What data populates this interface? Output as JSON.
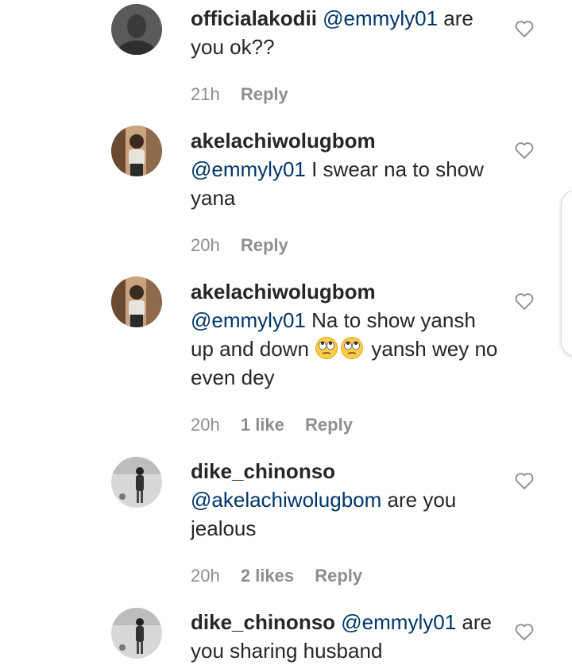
{
  "comments": [
    {
      "username": "officialakodii",
      "mention": "@emmyly01",
      "text": "are you ok??",
      "time": "21h",
      "likes": "",
      "reply": "Reply",
      "avatar": "dark-face-avatar"
    },
    {
      "username": "akelachiwolugbom",
      "mention": "@emmyly01",
      "text": "I swear na to show yana",
      "time": "20h",
      "likes": "",
      "reply": "Reply",
      "avatar": "woman-photo-avatar"
    },
    {
      "username": "akelachiwolugbom",
      "mention": "@emmyly01",
      "text_before_emoji": "Na to show yansh up and down",
      "emoji": "face-with-rolling-eyes x2",
      "text_after_emoji": "yansh wey no even dey",
      "time": "20h",
      "likes": "1 like",
      "reply": "Reply",
      "avatar": "woman-photo-avatar"
    },
    {
      "username": "dike_chinonso",
      "mention": "@akelachiwolugbom",
      "text": "are you jealous",
      "time": "20h",
      "likes": "2 likes",
      "reply": "Reply",
      "avatar": "standing-figure-avatar"
    },
    {
      "username": "dike_chinonso",
      "mention": "@emmyly01",
      "text": "are you sharing husband",
      "avatar": "standing-figure-avatar"
    }
  ],
  "icons": {
    "like": "heart-outline-icon"
  },
  "colors": {
    "text": "#262626",
    "mention": "#003569",
    "meta": "#8e8e8e"
  }
}
